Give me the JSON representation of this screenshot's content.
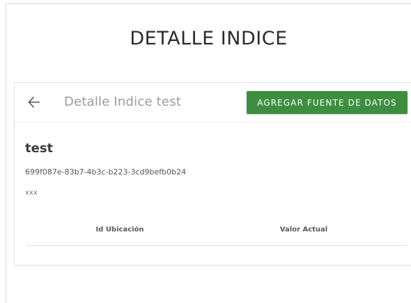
{
  "header": {
    "title": "DETALLE INDICE"
  },
  "toolbar": {
    "back_icon": "arrow-left-icon",
    "title": "Detalle Indice test",
    "add_button_label": "AGREGAR FUENTE DE DATOS",
    "add_button_color": "#3d8f3f"
  },
  "index": {
    "name": "test",
    "id": "699f087e-83b7-4b3c-b223-3cd9befb0b24",
    "description": "xxx"
  },
  "table": {
    "columns": [
      "Id Ubicación",
      "Valor Actual"
    ],
    "rows": []
  }
}
